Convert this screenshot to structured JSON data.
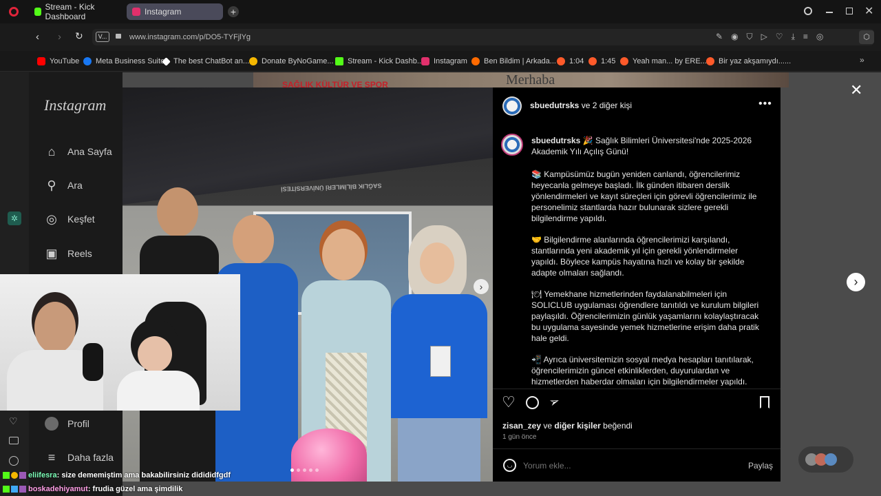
{
  "browser": {
    "tabs": [
      {
        "label": "Stream - Kick Dashboard",
        "color": "#53fc18"
      },
      {
        "label": "Instagram",
        "color": "#e1306c"
      }
    ],
    "url": "www.instagram.com/p/DO5-TYFjlYg",
    "site_info": "V...",
    "bookmarks": [
      {
        "label": "YouTube",
        "color": "#ff0000"
      },
      {
        "label": "Meta Business Suite",
        "color": "#1877f2"
      },
      {
        "label": "The best ChatBot an...",
        "color": "#ffffff"
      },
      {
        "label": "Donate ByNoGame...",
        "color": "#f5b700"
      },
      {
        "label": "Stream - Kick Dashb...",
        "color": "#53fc18"
      },
      {
        "label": "Instagram",
        "color": "#e1306c"
      },
      {
        "label": "Ben Bildim | Arkada...",
        "color": "#ff6a00"
      },
      {
        "label": "1:04",
        "color": "#ff5a2a"
      },
      {
        "label": "1:45",
        "color": "#ff5a2a"
      },
      {
        "label": "Yeah man... by ERE...",
        "color": "#ff5a2a"
      },
      {
        "label": "Bir yaz akşamıydı......",
        "color": "#ff5a2a"
      }
    ]
  },
  "instagram": {
    "logo": "Instagram",
    "nav": [
      {
        "label": "Ana Sayfa",
        "icon": "home-icon"
      },
      {
        "label": "Ara",
        "icon": "search-icon"
      },
      {
        "label": "Keşfet",
        "icon": "compass-icon"
      },
      {
        "label": "Reels",
        "icon": "reels-icon"
      }
    ],
    "nav_bottom": [
      {
        "label": "Profil",
        "icon": "avatar"
      },
      {
        "label": "Daha fazla",
        "icon": "menu-icon"
      }
    ],
    "post": {
      "header": "sbuedutrsks ve 2 diğer kişi",
      "header_user": "sbuedutrsks",
      "header_rest": "ve 2 diğer kişi",
      "caption_user": "sbuedutrsks",
      "caption_intro": "🎉 Sağlık Bilimleri Üniversitesi'nde 2025-2026 Akademik Yılı Açılış Günü!",
      "paragraphs": [
        "📚 Kampüsümüz bugün yeniden canlandı, öğrencilerimiz heyecanla gelmeye başladı. İlk günden itibaren derslik yönlendirmeleri ve kayıt süreçleri için görevli öğrencilerimiz ile personelimiz stantlarda hazır bulunarak sizlere gerekli bilgilendirme yapıldı.",
        "🤝 Bilgilendirme alanlarında öğrencilerimizi karşılandı, stantlarında yeni akademik yıl için gerekli yönlendirmeler yapıldı. Böylece kampüs hayatına hızlı ve kolay bir şekilde adapte olmaları sağlandı.",
        "🍽 Yemekhane hizmetlerinden faydalanabilmeleri için SOLICLUB uygulaması öğrendlere tanıtıldı ve kurulum bilgileri paylaşıldı. Öğrencilerimizin günlük yaşamlarını kolaylaştıracak bu uygulama sayesinde yemek hizmetlerine erişim daha pratik hale geldi.",
        "📲 Ayrıca üniversitemizin sosyal medya hesapları tanıtılarak, öğrencilerimizin güncel etkinliklerden, duyurulardan ve hizmetlerden haberdar olmaları için bilgilendirmeler yapıldı."
      ],
      "likes_user": "zisan_zey",
      "likes_mid": "ve",
      "likes_others": "diğer kişiler",
      "likes_end": "beğendi",
      "time": "1 gün önce",
      "comment_placeholder": "Yorum ekle...",
      "share_label": "Paylaş",
      "tent_text": "SAĞLIK BİLİMLERİ ÜNİVERSİTESİ",
      "banner_text": "SAĞLIK KÜLTÜR VE SPOR",
      "banner_text2": "Merhaba"
    }
  },
  "chat": [
    {
      "user": "eliifesra",
      "message": ": size dememiştim ama bakabilirsiniz didididfgdf",
      "color": "#7cffb8"
    },
    {
      "user": "boskadehiyamut",
      "message": ": frudia güzel ama şimdilik",
      "color": "#ff9ee6"
    }
  ]
}
